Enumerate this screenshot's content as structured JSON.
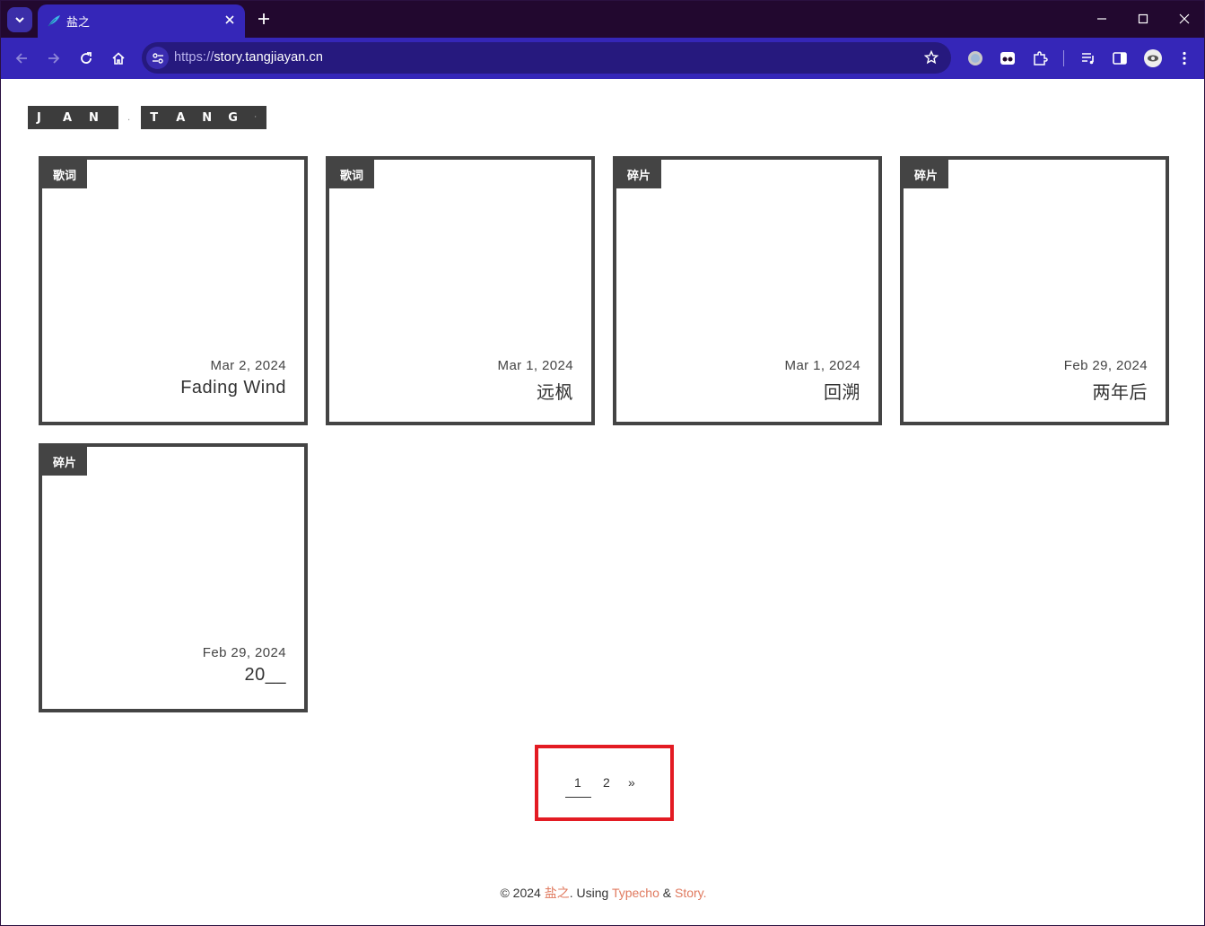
{
  "browser": {
    "tab_title": "盐之",
    "url_scheme": "https://",
    "url_host": "story.tangjiayan.cn",
    "accent_color": "#3526b8",
    "frame_color": "#22082f"
  },
  "site": {
    "logo_letters_1": [
      "J",
      "A",
      "N"
    ],
    "logo_separator": ".",
    "logo_letters_2": [
      "T",
      "A",
      "N",
      "G"
    ],
    "logo_tail": "·"
  },
  "posts": [
    {
      "category": "歌词",
      "date": "Mar 2, 2024",
      "title": "Fading Wind"
    },
    {
      "category": "歌词",
      "date": "Mar 1, 2024",
      "title": "远枫"
    },
    {
      "category": "碎片",
      "date": "Mar 1, 2024",
      "title": "回溯"
    },
    {
      "category": "碎片",
      "date": "Feb 29, 2024",
      "title": "两年后"
    },
    {
      "category": "碎片",
      "date": "Feb 29, 2024",
      "title": "20__"
    }
  ],
  "pagination": {
    "current": "1",
    "next_page": "2",
    "next_label": "»"
  },
  "footer": {
    "copyright": "© 2024",
    "author": "盐之",
    "using_text": ". Using",
    "engine": "Typecho",
    "amp": "&",
    "theme": "Story",
    "end": "."
  }
}
